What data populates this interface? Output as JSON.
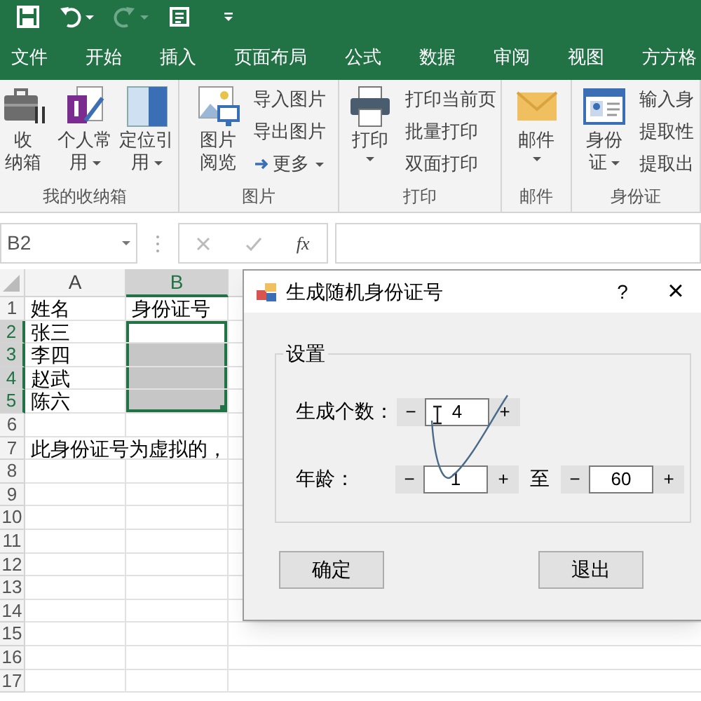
{
  "tabs": [
    {
      "label": "文件",
      "selected": false
    },
    {
      "label": "开始",
      "selected": false
    },
    {
      "label": "插入",
      "selected": false
    },
    {
      "label": "页面布局",
      "selected": false
    },
    {
      "label": "公式",
      "selected": false
    },
    {
      "label": "数据",
      "selected": false
    },
    {
      "label": "审阅",
      "selected": false
    },
    {
      "label": "视图",
      "selected": false
    },
    {
      "label": "方方格",
      "selected": false
    }
  ],
  "ribbon_groups": [
    {
      "name": "我的收纳箱",
      "large_buttons": [
        {
          "lines": [
            "收",
            "纳箱"
          ],
          "dropdown": false
        },
        {
          "lines": [
            "个人常",
            "用"
          ],
          "dropdown": true
        },
        {
          "lines": [
            "定位引",
            "用"
          ],
          "dropdown": true
        }
      ]
    },
    {
      "name": "图片",
      "large_buttons": [
        {
          "lines": [
            "图片",
            "阅览"
          ],
          "dropdown": false
        }
      ],
      "small_buttons": [
        {
          "label": "导入图片",
          "dropdown": false
        },
        {
          "label": "导出图片",
          "dropdown": false
        },
        {
          "label": "更多",
          "dropdown": true
        }
      ]
    },
    {
      "name": "打印",
      "large_buttons": [
        {
          "lines": [
            "打印"
          ],
          "dropdown": true
        }
      ],
      "small_buttons": [
        {
          "label": "打印当前页",
          "dropdown": false
        },
        {
          "label": "批量打印",
          "dropdown": false
        },
        {
          "label": "双面打印",
          "dropdown": false
        }
      ]
    },
    {
      "name": "邮件",
      "large_buttons": [
        {
          "lines": [
            "邮件"
          ],
          "dropdown": true
        }
      ]
    },
    {
      "name": "身份证",
      "large_buttons": [
        {
          "lines": [
            "身份",
            "证"
          ],
          "dropdown": true
        }
      ],
      "small_buttons": [
        {
          "label": "输入身",
          "dropdown": false
        },
        {
          "label": "提取性",
          "dropdown": false
        },
        {
          "label": "提取出",
          "dropdown": false
        }
      ]
    }
  ],
  "formula_bar": {
    "name_box": "B2",
    "function_label": "fx"
  },
  "sheet": {
    "columns": [
      {
        "label": "A",
        "selected": false
      },
      {
        "label": "B",
        "selected": true
      }
    ],
    "rows": [
      {
        "number": "1",
        "selected": false,
        "cells": [
          {
            "text": "姓名",
            "selected": false
          },
          {
            "text": "身份证号",
            "selected": false
          }
        ]
      },
      {
        "number": "2",
        "selected": true,
        "cells": [
          {
            "text": "张三",
            "selected": false
          },
          {
            "selected": false
          }
        ]
      },
      {
        "number": "3",
        "selected": true,
        "cells": [
          {
            "text": "李四",
            "selected": false
          },
          {
            "selected": true
          }
        ]
      },
      {
        "number": "4",
        "selected": true,
        "cells": [
          {
            "text": "赵武",
            "selected": false
          },
          {
            "selected": true
          }
        ]
      },
      {
        "number": "5",
        "selected": true,
        "cells": [
          {
            "text": "陈六",
            "selected": false
          },
          {
            "selected": true
          }
        ]
      },
      {
        "number": "6",
        "selected": false,
        "cells": [
          {
            "selected": false
          },
          {
            "selected": false
          }
        ]
      },
      {
        "number": "7",
        "selected": false,
        "cells": [
          {
            "text": "此身份证号为虚拟的，",
            "selected": false
          }
        ]
      },
      {
        "number": "8",
        "selected": false,
        "cells": [
          {
            "selected": false
          },
          {
            "selected": false
          }
        ]
      },
      {
        "number": "9",
        "selected": false,
        "cells": [
          {
            "selected": false
          },
          {
            "selected": false
          }
        ]
      },
      {
        "number": "10",
        "selected": false,
        "cells": [
          {
            "selected": false
          },
          {
            "selected": false
          }
        ]
      },
      {
        "number": "11",
        "selected": false,
        "cells": [
          {
            "selected": false
          },
          {
            "selected": false
          }
        ]
      },
      {
        "number": "12",
        "selected": false,
        "cells": [
          {
            "selected": false
          },
          {
            "selected": false
          }
        ]
      },
      {
        "number": "13",
        "selected": false,
        "cells": [
          {
            "selected": false
          },
          {
            "selected": false
          }
        ]
      },
      {
        "number": "14",
        "selected": false,
        "cells": [
          {
            "selected": false
          },
          {
            "selected": false
          }
        ]
      },
      {
        "number": "15",
        "selected": false,
        "cells": [
          {
            "selected": false
          },
          {
            "selected": false
          }
        ]
      },
      {
        "number": "16",
        "selected": false,
        "cells": [
          {
            "selected": false
          },
          {
            "selected": false
          }
        ]
      },
      {
        "number": "17",
        "selected": false,
        "cells": [
          {
            "selected": false
          },
          {
            "selected": false
          }
        ]
      }
    ]
  },
  "dialog": {
    "title": "生成随机身份证号",
    "help": "?",
    "close": "×",
    "group_title": "设置",
    "count": {
      "label": "生成个数：",
      "spinner": {
        "decrement": "−",
        "value": "4",
        "increment": "+"
      }
    },
    "age": {
      "label": "年龄：",
      "from": {
        "decrement": "−",
        "value": "1",
        "increment": "+"
      },
      "separator": "至",
      "to": {
        "decrement": "−",
        "value": "60",
        "increment": "+"
      }
    },
    "buttons": [
      "确定",
      "退出"
    ]
  }
}
